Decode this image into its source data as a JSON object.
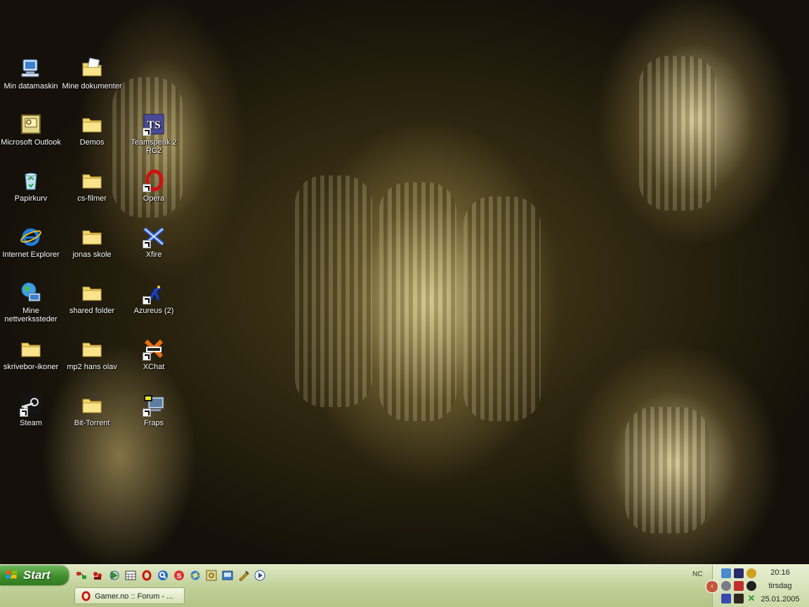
{
  "desktop": {
    "icons": [
      {
        "label": "Min datamaskin",
        "icon": "computer-icon"
      },
      {
        "label": "Mine dokumenter",
        "icon": "documents-folder-icon"
      },
      {
        "label": "Microsoft Outlook",
        "icon": "outlook-icon"
      },
      {
        "label": "Demos",
        "icon": "folder-icon"
      },
      {
        "label": "Teamspeak 2 RC2",
        "icon": "teamspeak-icon"
      },
      {
        "label": "Papirkurv",
        "icon": "recycle-bin-icon"
      },
      {
        "label": "cs-filmer",
        "icon": "folder-icon"
      },
      {
        "label": "Opera",
        "icon": "opera-icon"
      },
      {
        "label": "Internet Explorer",
        "icon": "internet-explorer-icon"
      },
      {
        "label": "jonas skole",
        "icon": "folder-icon"
      },
      {
        "label": "Xfire",
        "icon": "xfire-icon"
      },
      {
        "label": "Mine nettverkssteder",
        "icon": "network-places-icon"
      },
      {
        "label": "shared folder",
        "icon": "folder-icon"
      },
      {
        "label": "Azureus (2)",
        "icon": "azureus-icon"
      },
      {
        "label": "skrivebor-ikoner",
        "icon": "folder-icon"
      },
      {
        "label": "mp2 hans olav",
        "icon": "folder-icon"
      },
      {
        "label": "XChat",
        "icon": "xchat-icon"
      },
      {
        "label": "Steam",
        "icon": "steam-icon"
      },
      {
        "label": "Bit-Torrent",
        "icon": "folder-icon"
      },
      {
        "label": "Fraps",
        "icon": "fraps-icon"
      }
    ]
  },
  "taskbar": {
    "start_label": "Start",
    "task_button_label": "Gamer.no :: Forum - ...",
    "nc_label": "NC",
    "clock": {
      "time": "20:16",
      "day": "tirsdag",
      "date": "25.01.2005"
    }
  },
  "colors": {
    "start_green": "#3f8e2c",
    "taskbar_olive": "#c2d29a",
    "folder_yellow": "#f3d66a"
  }
}
